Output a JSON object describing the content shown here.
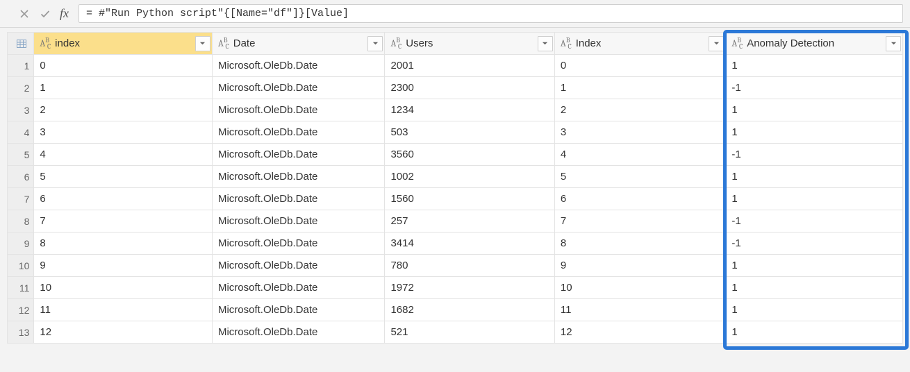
{
  "formula_bar": {
    "fx_label": "fx",
    "formula": "= #\"Run Python script\"{[Name=\"df\"]}[Value]"
  },
  "columns": [
    {
      "key": "index_lc",
      "label": "index",
      "selected": true
    },
    {
      "key": "date",
      "label": "Date",
      "selected": false
    },
    {
      "key": "users",
      "label": "Users",
      "selected": false
    },
    {
      "key": "index_uc",
      "label": "Index",
      "selected": false
    },
    {
      "key": "anomaly",
      "label": "Anomaly Detection",
      "selected": false
    }
  ],
  "rows": [
    {
      "n": "1",
      "index_lc": "0",
      "date": "Microsoft.OleDb.Date",
      "users": "2001",
      "index_uc": "0",
      "anomaly": "1"
    },
    {
      "n": "2",
      "index_lc": "1",
      "date": "Microsoft.OleDb.Date",
      "users": "2300",
      "index_uc": "1",
      "anomaly": "-1"
    },
    {
      "n": "3",
      "index_lc": "2",
      "date": "Microsoft.OleDb.Date",
      "users": "1234",
      "index_uc": "2",
      "anomaly": "1"
    },
    {
      "n": "4",
      "index_lc": "3",
      "date": "Microsoft.OleDb.Date",
      "users": "503",
      "index_uc": "3",
      "anomaly": "1"
    },
    {
      "n": "5",
      "index_lc": "4",
      "date": "Microsoft.OleDb.Date",
      "users": "3560",
      "index_uc": "4",
      "anomaly": "-1"
    },
    {
      "n": "6",
      "index_lc": "5",
      "date": "Microsoft.OleDb.Date",
      "users": "1002",
      "index_uc": "5",
      "anomaly": "1"
    },
    {
      "n": "7",
      "index_lc": "6",
      "date": "Microsoft.OleDb.Date",
      "users": "1560",
      "index_uc": "6",
      "anomaly": "1"
    },
    {
      "n": "8",
      "index_lc": "7",
      "date": "Microsoft.OleDb.Date",
      "users": "257",
      "index_uc": "7",
      "anomaly": "-1"
    },
    {
      "n": "9",
      "index_lc": "8",
      "date": "Microsoft.OleDb.Date",
      "users": "3414",
      "index_uc": "8",
      "anomaly": "-1"
    },
    {
      "n": "10",
      "index_lc": "9",
      "date": "Microsoft.OleDb.Date",
      "users": "780",
      "index_uc": "9",
      "anomaly": "1"
    },
    {
      "n": "11",
      "index_lc": "10",
      "date": "Microsoft.OleDb.Date",
      "users": "1972",
      "index_uc": "10",
      "anomaly": "1"
    },
    {
      "n": "12",
      "index_lc": "11",
      "date": "Microsoft.OleDb.Date",
      "users": "1682",
      "index_uc": "11",
      "anomaly": "1"
    },
    {
      "n": "13",
      "index_lc": "12",
      "date": "Microsoft.OleDb.Date",
      "users": "521",
      "index_uc": "12",
      "anomaly": "1"
    }
  ],
  "highlighted_column_key": "anomaly"
}
